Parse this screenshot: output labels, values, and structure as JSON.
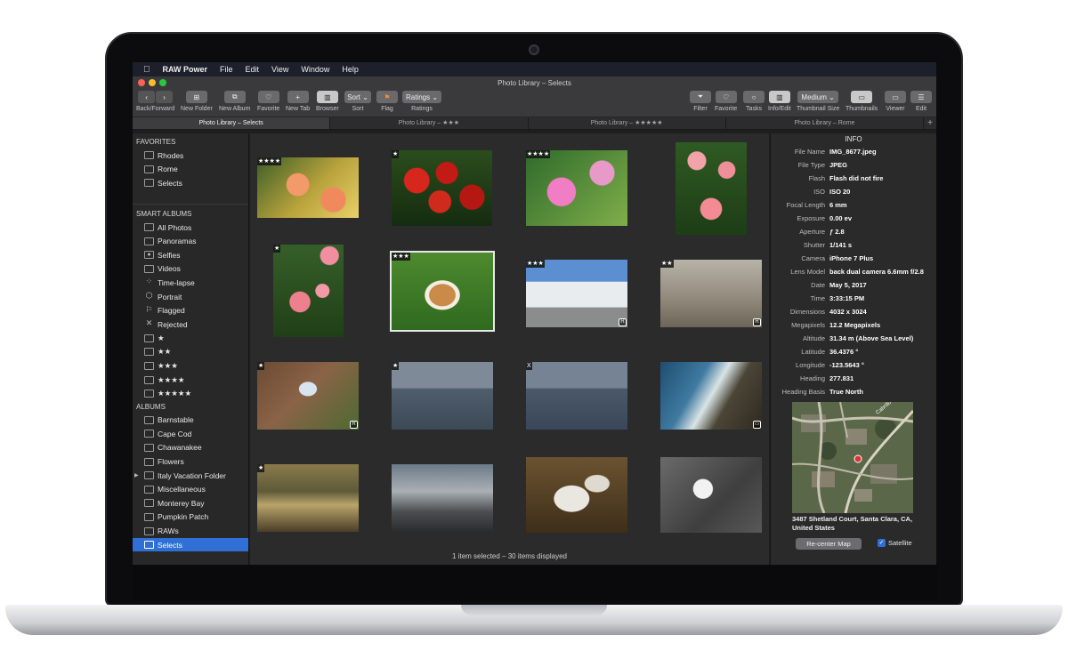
{
  "menubar": {
    "apple": "",
    "app": "RAW Power",
    "items": [
      "File",
      "Edit",
      "View",
      "Window",
      "Help"
    ]
  },
  "window": {
    "title": "Photo Library – Selects"
  },
  "toolbar": {
    "back_forward": "Back/Forward",
    "new_folder": "New Folder",
    "new_album": "New Album",
    "favorite": "Favorite",
    "new_tab": "New Tab",
    "browser": "Browser",
    "sort_btn": "Sort ⌄",
    "sort": "Sort",
    "flag": "Flag",
    "ratings_btn": "Ratings ⌄",
    "ratings": "Ratings",
    "filter": "Filter",
    "favorite_right": "Favorite",
    "tasks": "Tasks",
    "info_edit": "Info/Edit",
    "thumbnail_size_btn": "Medium ⌄",
    "thumbnail_size": "Thumbnail Size",
    "thumbnails": "Thumbnails",
    "viewer": "Viewer",
    "edit": "Edit"
  },
  "tabs": [
    "Photo Library – Selects",
    "Photo Library – ★★★",
    "Photo Library – ★★★★★",
    "Photo Library – Rome"
  ],
  "sidebar": {
    "favorites_header": "FAVORITES",
    "favorites": [
      "Rhodes",
      "Rome",
      "Selects"
    ],
    "smart_header": "SMART ALBUMS",
    "smart": [
      "All Photos",
      "Panoramas",
      "Selfies",
      "Videos",
      "Time-lapse",
      "Portrait",
      "Flagged",
      "Rejected",
      "★",
      "★★",
      "★★★",
      "★★★★",
      "★★★★★"
    ],
    "albums_header": "ALBUMS",
    "albums": [
      "Barnstable",
      "Cape Cod",
      "Chawanakee",
      "Flowers",
      "Italy Vacation Folder",
      "Miscellaneous",
      "Monterey Bay",
      "Pumpkin Patch",
      "RAWs",
      "Selects"
    ],
    "expand_arrow": "▶"
  },
  "photos": [
    {
      "stars": "★★★★",
      "badge": ""
    },
    {
      "stars": "★",
      "badge": ""
    },
    {
      "stars": "★★★★",
      "badge": ""
    },
    {
      "stars": "",
      "badge": ""
    },
    {
      "stars": "★",
      "badge": ""
    },
    {
      "stars": "★★★",
      "badge": ""
    },
    {
      "stars": "★★★",
      "badge": "R"
    },
    {
      "stars": "★★",
      "badge": "R"
    },
    {
      "stars": "★",
      "badge": "R"
    },
    {
      "stars": "★",
      "badge": ""
    },
    {
      "stars": "X",
      "badge": ""
    },
    {
      "stars": "",
      "badge": "▭"
    },
    {
      "stars": "★",
      "badge": ""
    },
    {
      "stars": "",
      "badge": ""
    },
    {
      "stars": "",
      "badge": ""
    },
    {
      "stars": "",
      "badge": ""
    }
  ],
  "status": "1 item selected – 30 items displayed",
  "info": {
    "title": "INFO",
    "rows": [
      {
        "k": "File Name",
        "v": "IMG_8677.jpeg"
      },
      {
        "k": "File Type",
        "v": "JPEG"
      },
      {
        "k": "Flash",
        "v": "Flash did not fire"
      },
      {
        "k": "ISO",
        "v": "ISO 20"
      },
      {
        "k": "Focal Length",
        "v": "6 mm"
      },
      {
        "k": "Exposure",
        "v": "0.00 ev"
      },
      {
        "k": "Aperture",
        "v": "ƒ 2.8"
      },
      {
        "k": "Shutter",
        "v": "1/141 s"
      },
      {
        "k": "Camera",
        "v": "iPhone 7 Plus"
      },
      {
        "k": "Lens Model",
        "v": "back dual camera 6.6mm f/2.8"
      },
      {
        "k": "Date",
        "v": "May 5, 2017"
      },
      {
        "k": "Time",
        "v": "3:33:15 PM"
      },
      {
        "k": "Dimensions",
        "v": "4032 x 3024"
      },
      {
        "k": "Megapixels",
        "v": "12.2 Megapixels"
      },
      {
        "k": "Altitude",
        "v": "31.34 m (Above Sea Level)"
      },
      {
        "k": "Latitude",
        "v": "36.4376 °"
      },
      {
        "k": "Longitude",
        "v": "-123.5643 °"
      },
      {
        "k": "Heading",
        "v": "277.831"
      },
      {
        "k": "Heading Basis",
        "v": "True North"
      }
    ],
    "map_street_label": "Cabrillo Ave",
    "address": "3487 Shetland Court, Santa Clara, CA, United States",
    "recenter": "Re-center Map",
    "satellite": "Satellite",
    "satellite_check": "✓"
  }
}
